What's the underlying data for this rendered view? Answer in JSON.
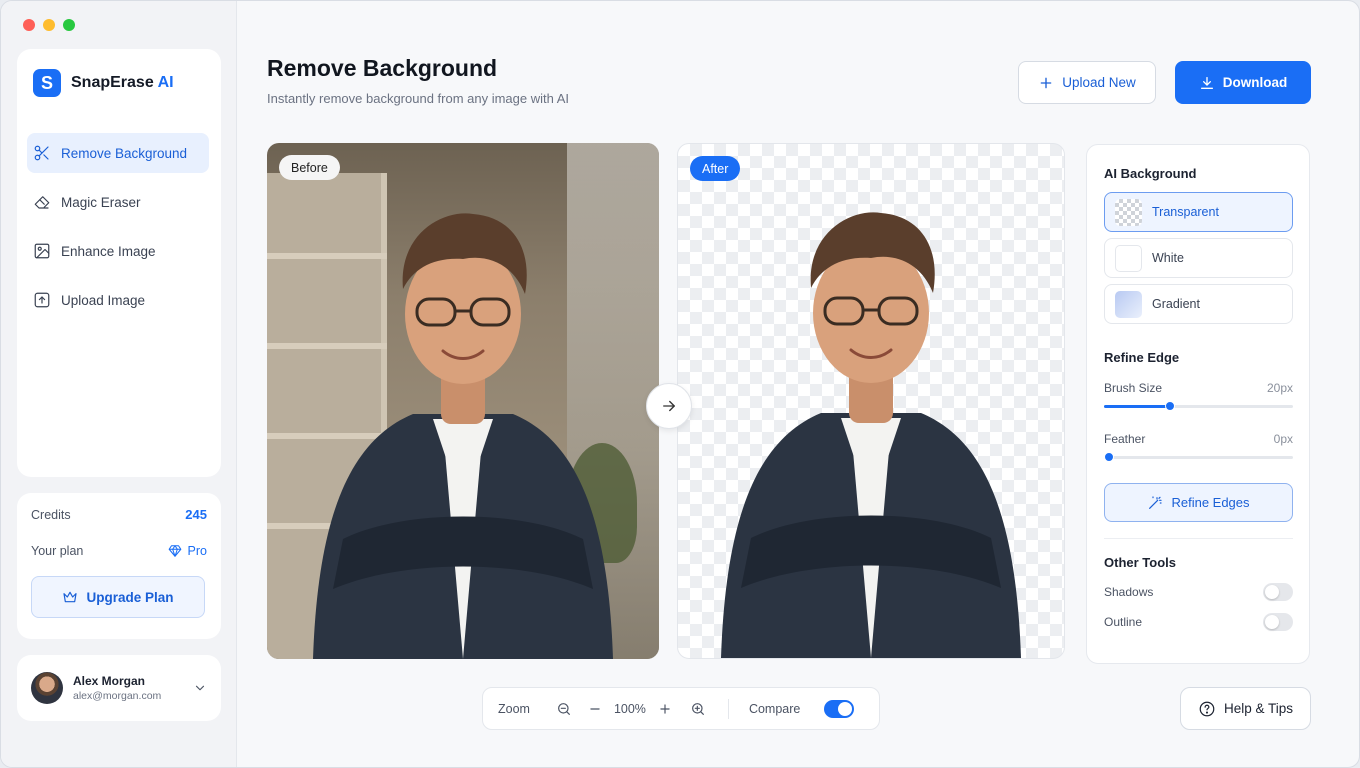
{
  "window": {
    "controls": [
      "close",
      "minimize",
      "maximize"
    ]
  },
  "brand": {
    "logo_letter": "S",
    "name": "SnapErase",
    "suffix": "AI",
    "accent": "#1a6ef5"
  },
  "sidebar": {
    "items": [
      {
        "label": "Remove Background",
        "icon": "wand-icon",
        "active": true
      },
      {
        "label": "Magic Eraser",
        "icon": "eraser-icon",
        "active": false
      },
      {
        "label": "Enhance Image",
        "icon": "image-icon",
        "active": false
      },
      {
        "label": "Upload Image",
        "icon": "upload-icon",
        "active": false
      }
    ],
    "credits_label": "Credits",
    "credits_value": "245",
    "plan_label": "Your plan",
    "plan_value": "Pro",
    "upgrade_label": "Upgrade Plan"
  },
  "user": {
    "name": "Alex Morgan",
    "email": "alex@morgan.com"
  },
  "header": {
    "title": "Remove Background",
    "subtitle": "Instantly remove background from any image with AI",
    "upload_label": "Upload New",
    "download_label": "Download"
  },
  "preview": {
    "before_tag": "Before",
    "after_tag": "After"
  },
  "panel": {
    "bg_title": "AI Background",
    "bg_options": [
      {
        "label": "Transparent",
        "selected": true
      },
      {
        "label": "White",
        "selected": false
      },
      {
        "label": "Gradient",
        "selected": false
      }
    ],
    "refine_title": "Refine Edge",
    "brush_label": "Brush Size",
    "brush_value": "20px",
    "brush_level": 0.35,
    "feather_label": "Feather",
    "feather_value": "0px",
    "feather_level": 0,
    "refine_button": "Refine Edges",
    "other_title": "Other Tools",
    "shadows_label": "Shadows",
    "shadows_on": false,
    "outline_label": "Outline",
    "outline_on": false
  },
  "toolbar": {
    "zoom_label": "Zoom",
    "zoom_value": "100%",
    "compare_label": "Compare",
    "compare_on": true
  },
  "help": {
    "label": "Help & Tips"
  }
}
